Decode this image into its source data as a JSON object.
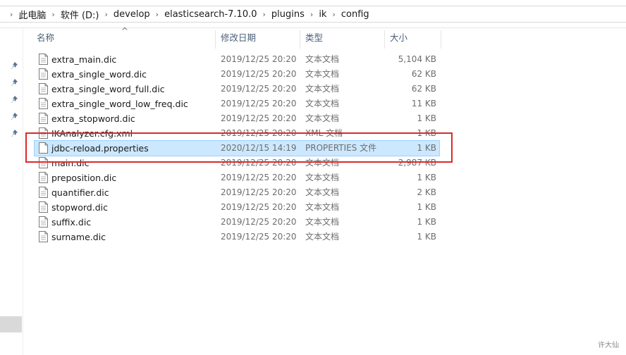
{
  "breadcrumb": {
    "items": [
      "此电脑",
      "软件 (D:)",
      "develop",
      "elasticsearch-7.10.0",
      "plugins",
      "ik",
      "config"
    ]
  },
  "columns": {
    "name": "名称",
    "date": "修改日期",
    "type": "类型",
    "size": "大小"
  },
  "files": [
    {
      "name": "extra_main.dic",
      "date": "2019/12/25 20:20",
      "type": "文本文档",
      "size": "5,104 KB"
    },
    {
      "name": "extra_single_word.dic",
      "date": "2019/12/25 20:20",
      "type": "文本文档",
      "size": "62 KB"
    },
    {
      "name": "extra_single_word_full.dic",
      "date": "2019/12/25 20:20",
      "type": "文本文档",
      "size": "62 KB"
    },
    {
      "name": "extra_single_word_low_freq.dic",
      "date": "2019/12/25 20:20",
      "type": "文本文档",
      "size": "11 KB"
    },
    {
      "name": "extra_stopword.dic",
      "date": "2019/12/25 20:20",
      "type": "文本文档",
      "size": "1 KB"
    },
    {
      "name": "IKAnalyzer.cfg.xml",
      "date": "2019/12/25 20:20",
      "type": "XML 文档",
      "size": "1 KB"
    },
    {
      "name": "jdbc-reload.properties",
      "date": "2020/12/15 14:19",
      "type": "PROPERTIES 文件",
      "size": "1 KB",
      "selected": true
    },
    {
      "name": "main.dic",
      "date": "2019/12/25 20:20",
      "type": "文本文档",
      "size": "2,987 KB"
    },
    {
      "name": "preposition.dic",
      "date": "2019/12/25 20:20",
      "type": "文本文档",
      "size": "1 KB"
    },
    {
      "name": "quantifier.dic",
      "date": "2019/12/25 20:20",
      "type": "文本文档",
      "size": "2 KB"
    },
    {
      "name": "stopword.dic",
      "date": "2019/12/25 20:20",
      "type": "文本文档",
      "size": "1 KB"
    },
    {
      "name": "suffix.dic",
      "date": "2019/12/25 20:20",
      "type": "文本文档",
      "size": "1 KB"
    },
    {
      "name": "surname.dic",
      "date": "2019/12/25 20:20",
      "type": "文本文档",
      "size": "1 KB"
    }
  ],
  "watermark": "许大仙",
  "colors": {
    "selection": "#cce8ff",
    "annotation": "#d92b2b",
    "header_text": "#4c607a"
  },
  "icons": {
    "pin": "pin-icon",
    "file": "document-icon",
    "sort": "sort-up-icon"
  }
}
